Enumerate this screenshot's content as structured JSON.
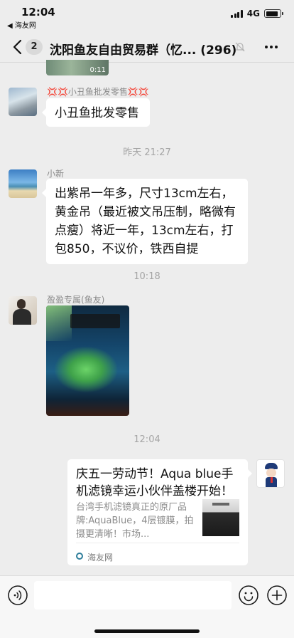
{
  "status_bar": {
    "time": "12:04",
    "back_app": "◀ 海友网",
    "network": "4G",
    "battery_level": 0.85
  },
  "nav": {
    "unread_badge": "2",
    "title": "沈阳鱼友自由贸易群（忆...",
    "member_count": "(296)"
  },
  "messages": {
    "video_duration": "0:11",
    "msg1": {
      "sender": "💢💢小丑鱼批发零售💢💢",
      "text": "小丑鱼批发零售"
    },
    "timestamp1": "昨天 21:27",
    "msg2": {
      "sender": "小新",
      "text": "出紫吊一年多，尺寸13cm左右，黄金吊（最近被文吊压制，略微有点瘦）将近一年，13cm左右，打包850，不议价，铁西自提"
    },
    "timestamp2": "10:18",
    "msg3": {
      "sender": "盈盈专属(鱼友)"
    },
    "timestamp3": "12:04",
    "link_card": {
      "title": "庆五一劳动节！Aqua blue手机滤镜幸运小伙伴盖楼开始！",
      "description": "台湾手机滤镜真正的原厂品牌:AquaBlue，4层镀膜，拍摄更清晰！市场...",
      "source": "海友网"
    }
  },
  "icons": {
    "back": "chevron-left-icon",
    "mute": "bell-slash-icon",
    "more": "ellipsis-icon",
    "voice": "voice-icon",
    "emoji": "emoji-icon",
    "plus": "plus-icon"
  }
}
